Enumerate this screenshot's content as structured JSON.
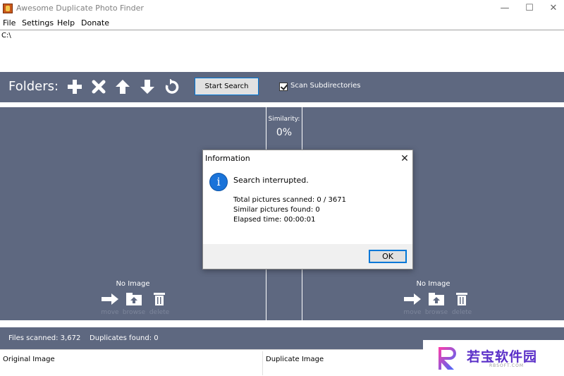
{
  "window": {
    "title": "Awesome Duplicate Photo Finder",
    "minimize": "—",
    "maximize": "☐",
    "close": "✕"
  },
  "menu": {
    "file": "File",
    "settings": "Settings",
    "help": "Help",
    "donate": "Donate"
  },
  "path_list": [
    "C:\\"
  ],
  "toolbar": {
    "folders_label": "Folders:",
    "icons": [
      "add-folder-icon",
      "remove-folder-icon",
      "move-up-icon",
      "move-down-icon",
      "refresh-icon"
    ],
    "start_search": "Start Search",
    "scan_subdirectories_label": "Scan Subdirectories",
    "scan_subdirectories_checked": true
  },
  "similarity": {
    "label": "Similarity:",
    "value": "0%"
  },
  "left_panel": {
    "no_image": "No Image",
    "actions": [
      "move",
      "browse",
      "delete"
    ]
  },
  "right_panel": {
    "no_image": "No Image",
    "actions": [
      "move",
      "browse",
      "delete"
    ]
  },
  "status": {
    "text": "Files scanned: 3,672    Duplicates found: 0"
  },
  "list": {
    "col_original": "Original Image",
    "col_duplicate": "Duplicate Image"
  },
  "dialog": {
    "title": "Information",
    "close": "✕",
    "icon": "info-icon",
    "message": "Search interrupted.",
    "total": "Total pictures scanned: 0 / 3671",
    "similar": "Similar pictures found: 0",
    "elapsed": "Elapsed time: 00:00:01",
    "ok": "OK"
  },
  "watermark": {
    "text": "若宝软件园",
    "sub": "RBSOFT.COM"
  },
  "colors": {
    "panel": "#5e6880",
    "accent": "#0078d7",
    "info": "#1a73d9"
  }
}
